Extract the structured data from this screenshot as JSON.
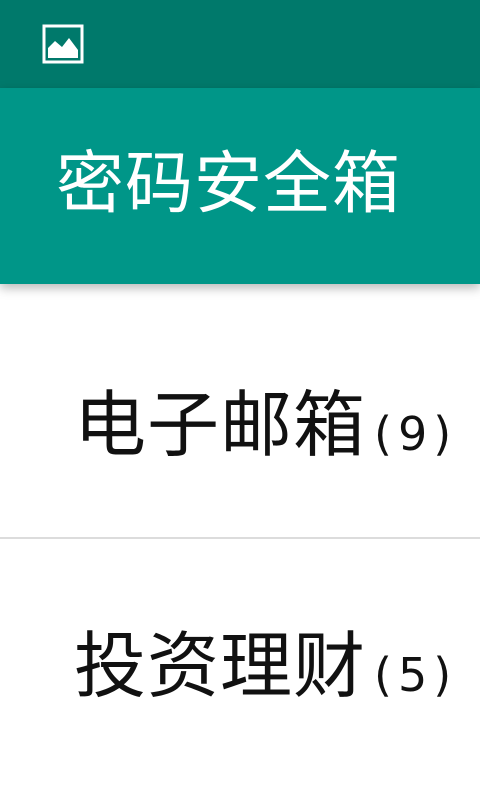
{
  "status_bar": {
    "icon": "image-icon",
    "color": "#00796b"
  },
  "app_bar": {
    "title": "密码安全箱",
    "color": "#009688"
  },
  "categories": [
    {
      "label": "电子邮箱",
      "count": "(9)"
    },
    {
      "label": "投资理财",
      "count": "(5)"
    }
  ]
}
